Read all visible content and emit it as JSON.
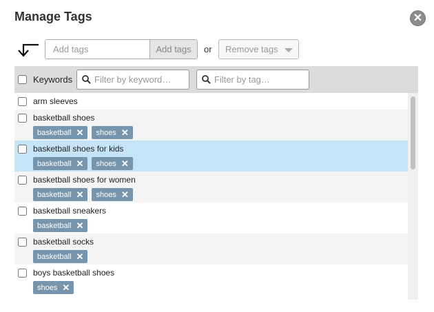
{
  "dialog": {
    "title": "Manage Tags",
    "close_icon": "close-icon"
  },
  "toolbar": {
    "back_icon": "return-arrow-icon",
    "tag_input_placeholder": "Add tags",
    "add_tags_label": "Add tags",
    "or_label": "or",
    "remove_tags_label": "Remove tags"
  },
  "table_header": {
    "keywords_label": "Keywords",
    "filter_keyword_placeholder": "Filter by keyword…",
    "filter_tag_placeholder": "Filter by tag…"
  },
  "rows": [
    {
      "keyword": "arm sleeves",
      "tags": [],
      "selected": false
    },
    {
      "keyword": "basketball shoes",
      "tags": [
        "basketball",
        "shoes"
      ],
      "selected": false
    },
    {
      "keyword": "basketball shoes for kids",
      "tags": [
        "basketball",
        "shoes"
      ],
      "selected": true
    },
    {
      "keyword": "basketball shoes for women",
      "tags": [
        "basketball",
        "shoes"
      ],
      "selected": false
    },
    {
      "keyword": "basketball sneakers",
      "tags": [
        "basketball"
      ],
      "selected": false
    },
    {
      "keyword": "basketball socks",
      "tags": [
        "basketball"
      ],
      "selected": false
    },
    {
      "keyword": "boys basketball shoes",
      "tags": [
        "shoes"
      ],
      "selected": false
    }
  ],
  "colors": {
    "header_bg": "#dcdcdc",
    "selected_row_bg": "#c6e4f7",
    "chip_bg": "#7795ac"
  }
}
